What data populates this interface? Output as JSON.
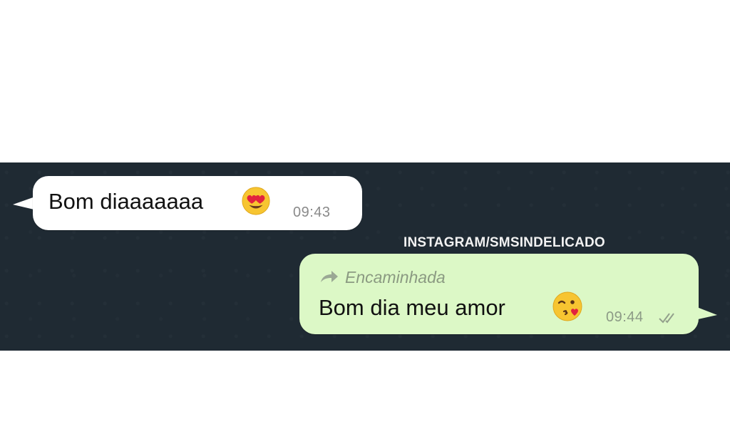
{
  "watermark": "INSTAGRAM/SMSINDELICADO",
  "incoming": {
    "text": "Bom diaaaaaaa",
    "emoji": "heart-eyes-emoji",
    "time": "09:43"
  },
  "outgoing": {
    "forward_label": "Encaminhada",
    "text": "Bom dia meu amor",
    "emoji": "kissing-heart-emoji",
    "time": "09:44",
    "status_icon": "double-check-icon"
  },
  "colors": {
    "chat_background": "#1f2a33",
    "incoming_bubble": "#ffffff",
    "outgoing_bubble": "#dcf8c6",
    "timestamp": "#8a8a8a"
  }
}
